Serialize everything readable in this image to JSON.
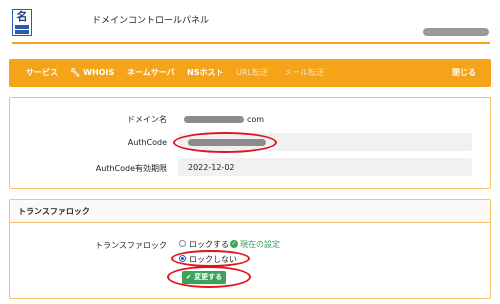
{
  "logo": {
    "glyph": "名"
  },
  "app": {
    "title": "ドメインコントロールパネル"
  },
  "nav": {
    "items": [
      {
        "label": "サービス"
      },
      {
        "label": "WHOIS",
        "icon": "wrench-icon"
      },
      {
        "label": "ネームサーバ"
      },
      {
        "label": "NSホスト"
      },
      {
        "label": "URL転送"
      },
      {
        "label": "メール転送"
      }
    ],
    "close": "閉じる"
  },
  "domain_info": {
    "domain_label": "ドメイン名",
    "domain_suffix": "com",
    "authcode_label": "AuthCode",
    "expiry_label": "AuthCode有効期限",
    "expiry_value": "2022-12-02"
  },
  "transfer_lock": {
    "title": "トランスファロック",
    "field_label": "トランスファロック",
    "option_lock": "ロックする",
    "current_setting": "現在の設定",
    "option_unlock": "ロックしない",
    "selected": "ロックしない",
    "submit": "変更する"
  },
  "colors": {
    "accent": "#f5a319",
    "success": "#3aa35b",
    "highlight": "#e1141b",
    "redacted": "#8c8c8c"
  }
}
